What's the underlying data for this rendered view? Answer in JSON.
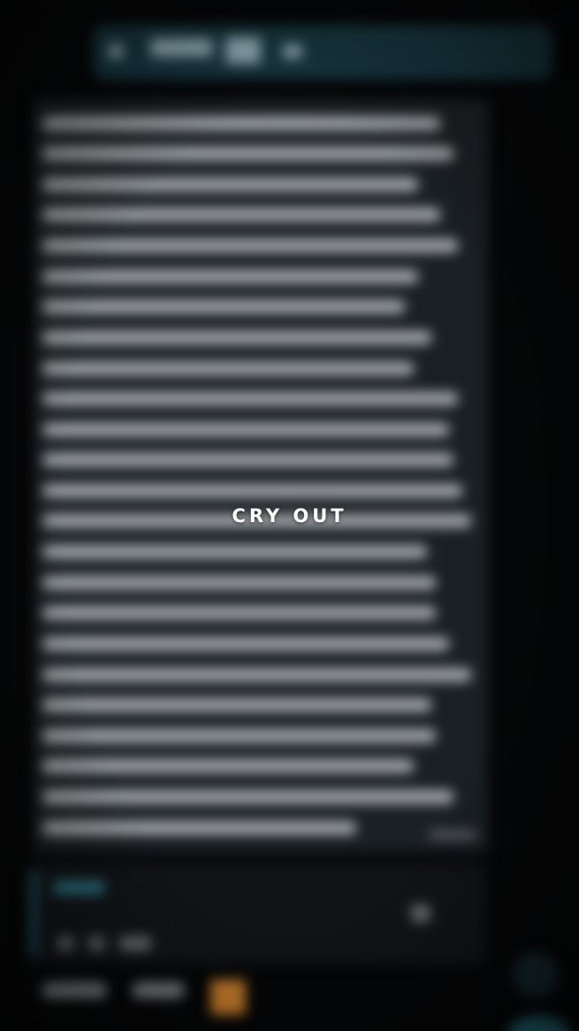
{
  "caption": {
    "text": "CRY OUT"
  },
  "colors": {
    "background": "#050607",
    "header": "#16343d",
    "bubble": "#1a1f23",
    "blurred_text": "#bfc4c8",
    "accent": "#2a6b79",
    "caption": "#ffffff"
  }
}
